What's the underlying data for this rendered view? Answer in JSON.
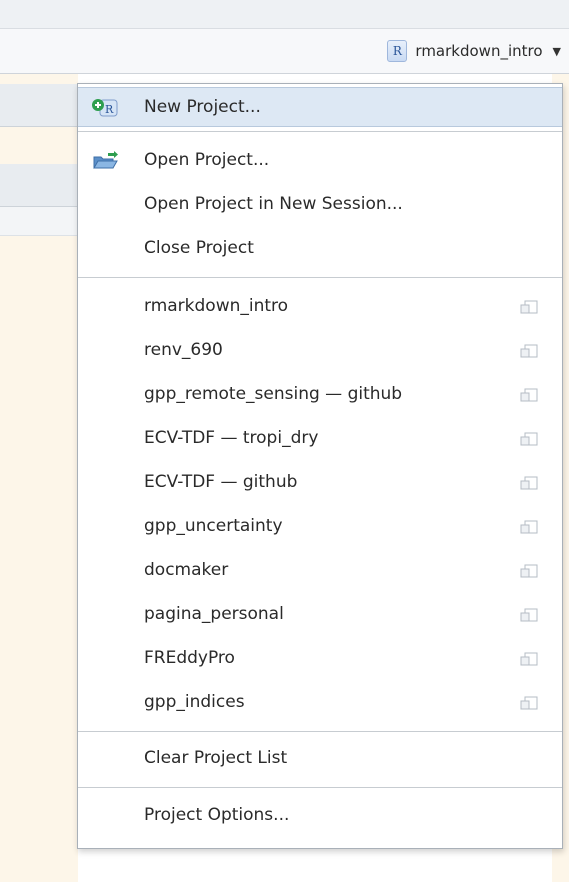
{
  "header": {
    "project_name": "rmarkdown_intro",
    "project_badge": "R"
  },
  "menu": {
    "items": [
      {
        "label": "New Project...",
        "icon": "new-project-icon"
      },
      {
        "label": "Open Project...",
        "icon": "open-folder-icon"
      },
      {
        "label": "Open Project in New Session..."
      },
      {
        "label": "Close Project"
      }
    ],
    "recent_projects": [
      "rmarkdown_intro",
      "renv_690",
      "gpp_remote_sensing — github",
      "ECV-TDF — tropi_dry",
      "ECV-TDF — github",
      "gpp_uncertainty",
      "docmaker",
      "pagina_personal",
      "FREddyPro",
      "gpp_indices"
    ],
    "clear_label": "Clear Project List",
    "options_label": "Project Options..."
  },
  "colors": {
    "selected_bg": "#dde8f4",
    "editor_bg": "#fdf6e9",
    "accent": "#2a5599"
  }
}
